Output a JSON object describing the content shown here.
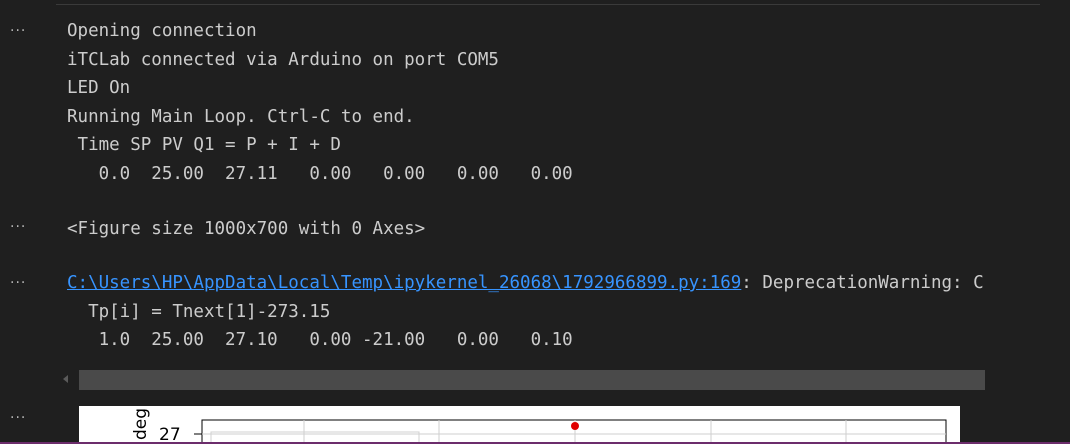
{
  "cells": [
    {
      "dots": "···",
      "lines": [
        "Opening connection",
        "iTCLab connected via Arduino on port COM5",
        "LED On",
        "Running Main Loop. Ctrl-C to end.",
        " Time SP PV Q1 = P + I + D",
        "   0.0  25.00  27.11   0.00   0.00   0.00   0.00"
      ]
    },
    {
      "dots": "···",
      "lines": [
        "<Figure size 1000x700 with 0 Axes>"
      ]
    },
    {
      "dots": "···",
      "link_text": "C:\\Users\\HP\\AppData\\Local\\Temp\\ipykernel_26068\\1792966899.py:169",
      "warning_suffix": ": DeprecationWarning: C",
      "lines": [
        "  Tp[i] = Tnext[1]-273.15",
        "   1.0  25.00  27.10   0.00 -21.00   0.00   0.10"
      ]
    },
    {
      "dots": "···"
    }
  ],
  "plot": {
    "ylabel": "deg",
    "ytick": "27",
    "point_color": "#e00000"
  }
}
